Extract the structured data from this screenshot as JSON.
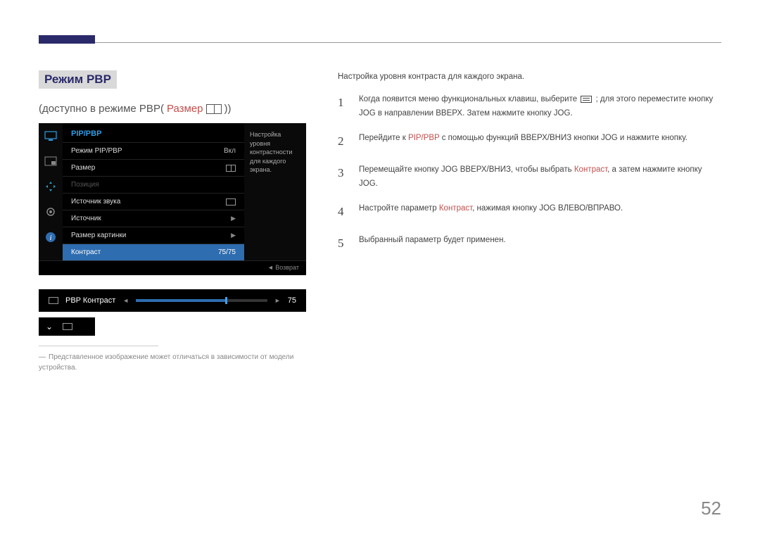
{
  "section_title": "Режим PBP",
  "subtitle_prefix": "(доступно в режиме PBP(",
  "subtitle_red": "Размер",
  "subtitle_suffix": "))",
  "osd": {
    "title": "PIP/PBP",
    "desc": "Настройка уровня контрастности для каждого экрана.",
    "footer": "◄ Возврат",
    "rows": [
      {
        "label": "Режим PIP/PBP",
        "value": "Вкл",
        "type": "value"
      },
      {
        "label": "Размер",
        "type": "icon-split"
      },
      {
        "label": "Позиция",
        "type": "disabled"
      },
      {
        "label": "Источник звука",
        "type": "icon-box"
      },
      {
        "label": "Источник",
        "type": "arrow"
      },
      {
        "label": "Размер картинки",
        "type": "arrow"
      },
      {
        "label": "Контраст",
        "value": "75/75",
        "type": "selected"
      }
    ]
  },
  "slider": {
    "label": "PBP Контраст",
    "value": "75"
  },
  "footnote": "Представленное изображение может отличаться в зависимости от модели устройства.",
  "intro": "Настройка уровня контраста для каждого экрана.",
  "steps": [
    {
      "num": "1",
      "pre": "Когда появится меню функциональных клавиш, выберите ",
      "icon": true,
      "post": " ; для этого переместите кнопку JOG в направлении ВВЕРХ. Затем нажмите кнопку JOG."
    },
    {
      "num": "2",
      "pre": "Перейдите к ",
      "red": "PIP/PBP",
      "post": " с помощью функций ВВЕРХ/ВНИЗ кнопки JOG и нажмите кнопку."
    },
    {
      "num": "3",
      "pre": "Перемещайте кнопку JOG ВВЕРХ/ВНИЗ, чтобы выбрать ",
      "red": "Контраст",
      "post": ", а затем нажмите кнопку JOG."
    },
    {
      "num": "4",
      "pre": "Настройте параметр ",
      "red": "Контраст",
      "post": ", нажимая кнопку JOG ВЛЕВО/ВПРАВО."
    },
    {
      "num": "5",
      "pre": "Выбранный параметр будет применен."
    }
  ],
  "page_number": "52"
}
